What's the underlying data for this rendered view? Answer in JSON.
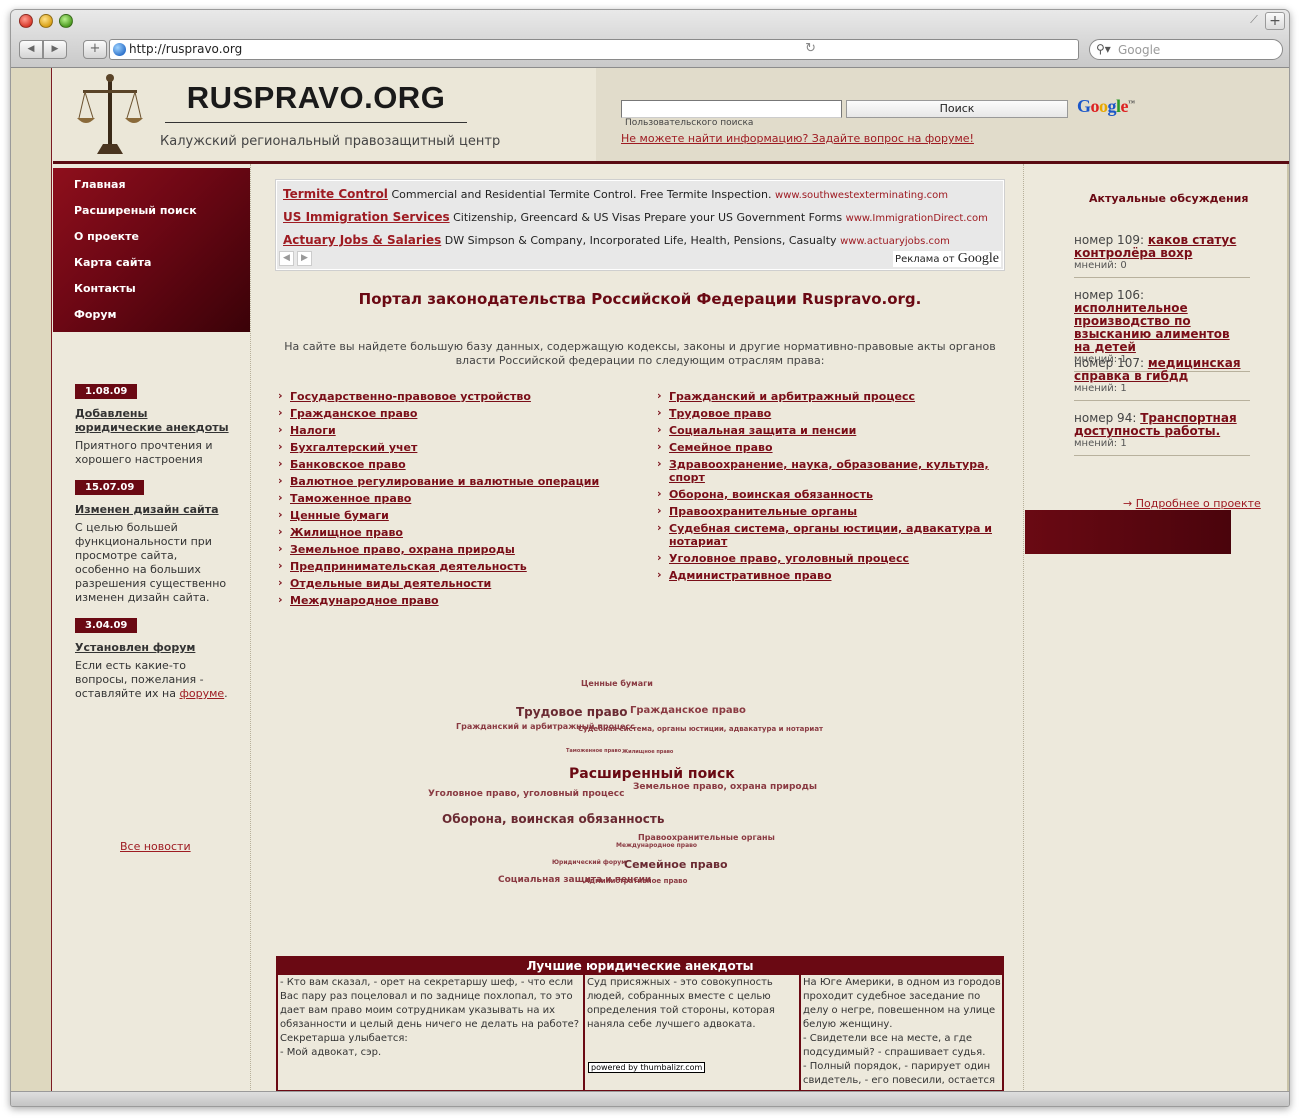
{
  "browser": {
    "url": "http://ruspravo.org",
    "search_placeholder": "Google"
  },
  "header": {
    "site_title": "RUSPRAVO.ORG",
    "subtitle": "Калужский региональный правозащитный центр",
    "search_button": "Поиск",
    "search_hint": "Пользовательского поиска",
    "google_logo": "Google",
    "forum_question": "Не можете найти информацию? Задайте вопрос на форуме!"
  },
  "menu": [
    "Главная",
    "Расширеный поиск",
    "О проекте",
    "Карта сайта",
    "Контакты",
    "Форум"
  ],
  "news": [
    {
      "date": "1.08.09",
      "title": "Добавлены юридические анекдоты",
      "text": "Приятного прочтения и хорошего настроения"
    },
    {
      "date": "15.07.09",
      "title": "Изменен дизайн сайта",
      "text": "С целью большей функциональности при просмотре сайта, особенно на больших разрешения существенно изменен дизайн сайта."
    },
    {
      "date": "3.04.09",
      "title": "Установлен форум",
      "text_before": "Если есть какие-то вопросы, пожелания - оставляйте их на ",
      "text_link": "форуме",
      "text_after": "."
    }
  ],
  "all_news": "Все новости",
  "ads": [
    {
      "title": "Termite Control",
      "text": "Commercial and Residential Termite Control. Free Termite Inspection.",
      "url": "www.southwestexterminating.com"
    },
    {
      "title": "US Immigration Services",
      "text": "Citizenship, Greencard & US Visas Prepare your US Government Forms",
      "url": "www.ImmigrationDirect.com"
    },
    {
      "title": "Actuary Jobs & Salaries",
      "text": "DW Simpson & Company, Incorporated Life, Health, Pensions, Casualty",
      "url": "www.actuaryjobs.com"
    }
  ],
  "ads_label": "Реклама от",
  "ads_google": "Google",
  "portal_title": "Портал законодательства Российской Федерации Ruspravo.org.",
  "portal_intro": "На сайте вы найдете большую базу данных, содержащую кодексы, законы и другие нормативно-правовые акты органов власти Российской федерации по следующим отраслям права:",
  "categories_left": [
    "Государственно-правовое устройство",
    "Гражданское право",
    "Налоги",
    "Бухгалтерский учет",
    "Банковское право",
    "Валютное регулирование и валютные операции",
    "Таможенное право",
    "Ценные бумаги",
    "Жилищное право",
    "Земельное право, охрана природы",
    "Предпринимательская деятельность",
    "Отдельные виды деятельности",
    "Международное право"
  ],
  "categories_right": [
    "Гражданский и арбитражный процесс",
    "Трудовое право",
    "Социальная защита и пенсии",
    "Семейное право",
    "Здравоохранение, наука, образование, культура, спорт",
    "Оборона, воинская обязанность",
    "Правоохранительные органы",
    "Судебная система, органы юстиции, адвакатура и нотариат",
    "Уголовное право, уголовный процесс",
    "Административное право"
  ],
  "tag_cloud": [
    "Ценные бумаги",
    "Трудовое право",
    "Гражданское право",
    "Гражданский и арбитражный процесс",
    "Судебная система, органы юстиции, адвакатура и нотариат",
    "Таможенное право",
    "Жилищное право",
    "Расширенный поиск",
    "Земельное право, охрана природы",
    "Уголовное право, уголовный процесс",
    "Оборона, воинская обязанность",
    "Правоохранительные органы",
    "Международное право",
    "Юридический форум",
    "Семейное право",
    "Социальная защита и пенсии",
    "Административное право"
  ],
  "jokes": {
    "title": "Лучшие юридические анекдоты",
    "joke1": "- Кто вам сказал, - орет на секретаршу шеф, - что если Вас пару раз поцеловал и по заднице похлопал, то это дает вам право моим сотрудникам указывать на их обязанности и целый день ничего не делать на работе?\nСекретарша улыбается:\n- Мой адвокат, сэр.",
    "joke2": "Суд присяжных - это совокупность людей, собранных вместе с целью определения той стороны, которая наняла себе лучшего адвоката.",
    "joke3": "На Юге Америки, в одном из городов проходит судебное заседание по делу о негре, повешенном на улице белую женщину.\n- Свидетели все на месте, а где подсудимый? - спрашивает судья.\n- Полный порядок, - парирует один свидетель, - его повесили, остается",
    "powered": "powered by thumbalizr.com"
  },
  "discussions": {
    "title": "Актуальные обсуждения",
    "items": [
      {
        "number": "номер 109:",
        "topic": "каков статус контролёра вохр",
        "meta": "мнений: 0"
      },
      {
        "number": "номер 106:",
        "topic": "исполнительное производство по взысканию алиментов на детей",
        "meta": "мнений: 1"
      },
      {
        "number": "номер 107:",
        "topic": "медицинская справка в гибдд",
        "meta": "мнений: 1"
      },
      {
        "number": "номер 94:",
        "topic": "Транспортная доступность работы.",
        "meta": "мнений: 1"
      }
    ]
  },
  "more_about": "Подробнее о проекте"
}
